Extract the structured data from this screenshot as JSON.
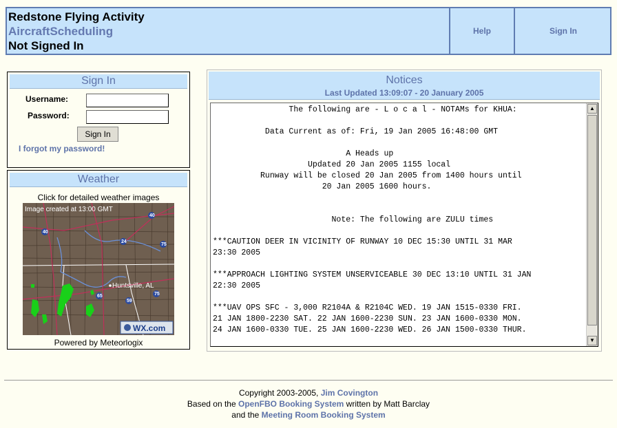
{
  "header": {
    "title": "Redstone Flying Activity",
    "app_name": "AircraftScheduling",
    "status": "Not Signed In",
    "help_label": "Help",
    "signin_label": "Sign In"
  },
  "signin_panel": {
    "title": "Sign In",
    "username_label": "Username:",
    "password_label": "Password:",
    "username_value": "",
    "password_value": "",
    "submit_label": "Sign In",
    "forgot_label": "I forgot my password!"
  },
  "weather_panel": {
    "title": "Weather",
    "caption": "Click for detailed weather images",
    "image_stamp": "Image created at 13:00 GMT",
    "city_label": "Huntsville, AL",
    "brand": "WX.com",
    "highway_shields": [
      "40",
      "40",
      "24",
      "75",
      "65",
      "59",
      "75"
    ],
    "powered_by": "Powered by Meteorlogix"
  },
  "notices": {
    "title": "Notices",
    "updated": "Last Updated 13:09:07 - 20 January 2005",
    "lines": [
      "                The following are - L o c a l - NOTAMs for KHUA:",
      "",
      "           Data Current as of: Fri, 19 Jan 2005 16:48:00 GMT",
      "",
      "                            A Heads up",
      "                    Updated 20 Jan 2005 1155 local",
      "          Runway will be closed 20 Jan 2005 from 1400 hours until",
      "                       20 Jan 2005 1600 hours.",
      "",
      "",
      "                         Note: The following are ZULU times",
      "",
      "***CAUTION DEER IN VICINITY OF RUNWAY 10 DEC 15:30 UNTIL 31 MAR",
      "23:30 2005",
      "",
      "***APPROACH LIGHTING SYSTEM UNSERVICEABLE 30 DEC 13:10 UNTIL 31 JAN",
      "22:30 2005",
      "",
      "***UAV OPS SFC - 3,000 R2104A & R2104C WED. 19 JAN 1515-0330 FRI.",
      "21 JAN 1800-2230 SAT. 22 JAN 1600-2230 SUN. 23 JAN 1600-0330 MON.",
      "24 JAN 1600-0330 TUE. 25 JAN 1600-2230 WED. 26 JAN 1500-0330 THUR."
    ]
  },
  "footer": {
    "copyright_prefix": "Copyright 2003-2005, ",
    "author_link": "Jim Covington",
    "based_prefix": "Based on the ",
    "openfbo_link": "OpenFBO Booking System",
    "based_suffix": " written by Matt Barclay",
    "and_prefix": "and the ",
    "mrbs_link": "Meeting Room Booking System"
  },
  "colors": {
    "header_bg": "#c6e3fb",
    "accent_text": "#5e73a9",
    "page_bg": "#fefef2"
  }
}
